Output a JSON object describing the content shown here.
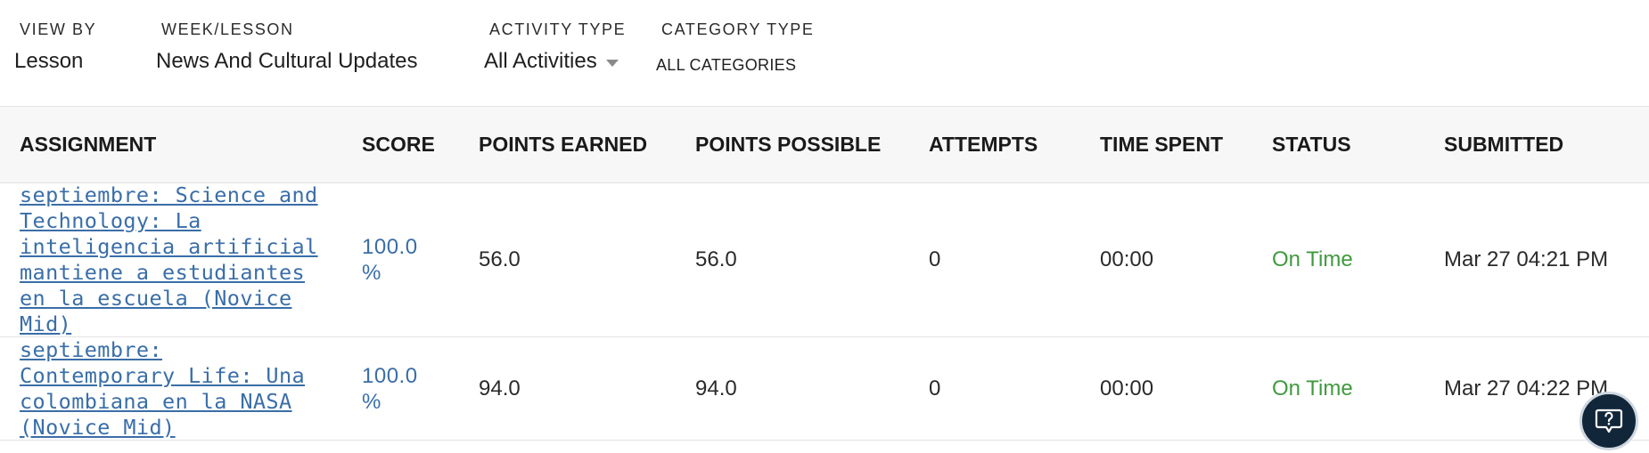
{
  "filters": {
    "view_by": {
      "label": "VIEW BY",
      "value": "Lesson"
    },
    "week_lesson": {
      "label": "WEEK/LESSON",
      "value": "News And Cultural Updates"
    },
    "activity_type": {
      "label": "ACTIVITY TYPE",
      "value": "All Activities"
    },
    "category_type": {
      "label": "CATEGORY TYPE",
      "value": "ALL CATEGORIES"
    }
  },
  "table": {
    "headers": [
      "ASSIGNMENT",
      "SCORE",
      "POINTS EARNED",
      "POINTS POSSIBLE",
      "ATTEMPTS",
      "TIME SPENT",
      "STATUS",
      "SUBMITTED"
    ],
    "rows": [
      {
        "assignment": "septiembre: Science and Technology: La inteligencia artificial mantiene a estudiantes en la escuela (Novice Mid)",
        "score": "100.0 %",
        "points_earned": "56.0",
        "points_possible": "56.0",
        "attempts": "0",
        "time_spent": "00:00",
        "status": "On Time",
        "submitted": "Mar 27 04:21 PM"
      },
      {
        "assignment": "septiembre: Contemporary Life: Una colombiana en la NASA (Novice Mid)",
        "score": "100.0 %",
        "points_earned": "94.0",
        "points_possible": "94.0",
        "attempts": "0",
        "time_spent": "00:00",
        "status": "On Time",
        "submitted": "Mar 27 04:22 PM"
      }
    ]
  },
  "help": {
    "icon": "help-chat-icon"
  },
  "colors": {
    "link": "#3a6ea8",
    "status_on_time": "#3f9a3f",
    "help_bg": "#12263a"
  }
}
